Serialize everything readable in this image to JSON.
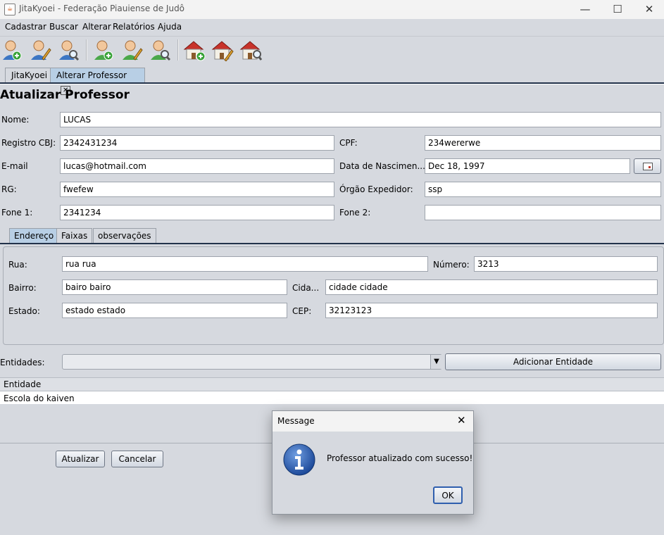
{
  "window": {
    "title": "JitaKyoei - Federação Piauiense de Judô",
    "minimize": "—",
    "maximize": "☐",
    "close": "✕"
  },
  "menu": [
    "Cadastrar",
    "Buscar",
    "Alterar",
    "Relatórios",
    "Ajuda"
  ],
  "toolbar": {
    "icons": [
      "add-user-icon",
      "edit-user-icon",
      "search-user-icon",
      "add-person-icon",
      "edit-person-icon",
      "search-person-icon",
      "add-house-icon",
      "edit-house-icon",
      "search-house-icon"
    ]
  },
  "tabs": [
    {
      "label": "JitaKyoei"
    },
    {
      "label": "Alterar Professor",
      "close": "✕"
    }
  ],
  "form": {
    "heading": "Atualizar Professor",
    "nome_label": "Nome:",
    "nome": "LUCAS",
    "registro_label": "Registro CBJ:",
    "registro": "2342431234",
    "cpf_label": "CPF:",
    "cpf": "234wererwe",
    "email_label": "E-mail",
    "email": "lucas@hotmail.com",
    "nascimento_label": "Data de Nascimen...",
    "nascimento": "Dec 18, 1997",
    "rg_label": "RG:",
    "rg": "fwefew",
    "orgao_label": "Órgão Expedidor:",
    "orgao": "ssp",
    "fone1_label": "Fone 1:",
    "fone1": "2341234",
    "fone2_label": "Fone 2:",
    "fone2": ""
  },
  "subtabs": [
    "Endereço",
    "Faixas",
    "observações"
  ],
  "endereco": {
    "rua_label": "Rua:",
    "rua": "rua rua",
    "numero_label": "Número:",
    "numero": "3213",
    "bairro_label": "Bairro:",
    "bairro": "bairo bairo",
    "cidade_label": "Cida...",
    "cidade": "cidade cidade",
    "estado_label": "Estado:",
    "estado": "estado estado",
    "cep_label": "CEP:",
    "cep": "32123123"
  },
  "entidades": {
    "label": "Entidades:",
    "selected": "",
    "add_button": "Adicionar Entidade",
    "column_header": "Entidade",
    "rows": [
      "Escola do kaiven"
    ]
  },
  "actions": {
    "update": "Atualizar",
    "cancel": "Cancelar"
  },
  "dialog": {
    "title": "Message",
    "close": "✕",
    "message": "Professor atualizado com sucesso!",
    "ok": "OK",
    "icon": "info-icon"
  },
  "colors": {
    "selected_tab": "#b8cfe5",
    "background": "#d6d9df",
    "info_blue": "#2f5fae"
  }
}
